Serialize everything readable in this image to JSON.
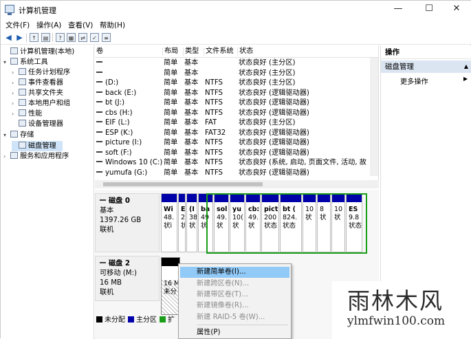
{
  "window": {
    "title": "计算机管理",
    "minimize": "—",
    "maximize": "☐",
    "close": "✕"
  },
  "menu": [
    "文件(F)",
    "操作(A)",
    "查看(V)",
    "帮助(H)"
  ],
  "tree": [
    {
      "label": "计算机管理(本地)",
      "arrow": ""
    },
    {
      "label": "系统工具",
      "arrow": "▾"
    },
    {
      "label": "任务计划程序",
      "arrow": "›"
    },
    {
      "label": "事件查看器",
      "arrow": "›"
    },
    {
      "label": "共享文件夹",
      "arrow": "›"
    },
    {
      "label": "本地用户和组",
      "arrow": "›"
    },
    {
      "label": "性能",
      "arrow": "›"
    },
    {
      "label": "设备管理器",
      "arrow": ""
    },
    {
      "label": "存储",
      "arrow": "▾"
    },
    {
      "label": "磁盘管理",
      "arrow": ""
    },
    {
      "label": "服务和应用程序",
      "arrow": "›"
    }
  ],
  "volumes": {
    "headers": [
      "卷",
      "布局",
      "类型",
      "文件系统",
      "状态"
    ],
    "rows": [
      [
        "",
        "简单",
        "基本",
        "",
        "状态良好 (主分区)"
      ],
      [
        "",
        "简单",
        "基本",
        "",
        "状态良好 (主分区)"
      ],
      [
        "(D:)",
        "简单",
        "基本",
        "NTFS",
        "状态良好 (主分区)"
      ],
      [
        "back (E:)",
        "简单",
        "基本",
        "NTFS",
        "状态良好 (逻辑驱动器)"
      ],
      [
        "bt (J:)",
        "简单",
        "基本",
        "NTFS",
        "状态良好 (逻辑驱动器)"
      ],
      [
        "cbs (H:)",
        "简单",
        "基本",
        "NTFS",
        "状态良好 (逻辑驱动器)"
      ],
      [
        "EIF (L:)",
        "简单",
        "基本",
        "FAT",
        "状态良好 (主分区)"
      ],
      [
        "ESP (K:)",
        "简单",
        "基本",
        "FAT32",
        "状态良好 (逻辑驱动器)"
      ],
      [
        "picture (I:)",
        "简单",
        "基本",
        "NTFS",
        "状态良好 (逻辑驱动器)"
      ],
      [
        "soft (F:)",
        "简单",
        "基本",
        "NTFS",
        "状态良好 (逻辑驱动器)"
      ],
      [
        "Windows 10 (C:)",
        "简单",
        "基本",
        "NTFS",
        "状态良好 (系统, 启动, 页面文件, 活动, 故"
      ],
      [
        "yumufa (G:)",
        "简单",
        "基本",
        "NTFS",
        "状态良好 (逻辑驱动器)"
      ]
    ]
  },
  "disk0": {
    "name": "磁盘 0",
    "type": "基本",
    "size": "1397.26 GB",
    "status": "联机",
    "partitions": [
      {
        "l1": "Wi",
        "l2": "48.",
        "l3": "状ì"
      },
      {
        "l1": "E",
        "l2": "2",
        "l3": "状"
      },
      {
        "l1": "(I",
        "l2": "38",
        "l3": "状"
      },
      {
        "l1": "ba",
        "l2": "49",
        "l3": "状"
      },
      {
        "l1": "sol",
        "l2": "49.",
        "l3": "状"
      },
      {
        "l1": "yu",
        "l2": "10(",
        "l3": "状"
      },
      {
        "l1": "cb:",
        "l2": "49.",
        "l3": "状"
      },
      {
        "l1": "pict",
        "l2": "200",
        "l3": "状态"
      },
      {
        "l1": "bt (",
        "l2": "824.",
        "l3": "状态"
      },
      {
        "l1": "",
        "l2": "10",
        "l3": "状"
      },
      {
        "l1": "",
        "l2": "8",
        "l3": "状"
      },
      {
        "l1": "",
        "l2": "10",
        "l3": "状"
      },
      {
        "l1": "ES",
        "l2": "9.8",
        "l3": "状态"
      }
    ]
  },
  "disk2": {
    "name": "磁盘 2",
    "type": "可移动 (M:)",
    "size": "16 MB",
    "status": "联机",
    "partition": {
      "l1": "16 M",
      "l2": "未分"
    }
  },
  "legend": [
    "未分配",
    "主分区",
    "扩"
  ],
  "legend_colors": {
    "unallocated": "#000000",
    "primary": "#0000a8",
    "extended": "#1a9e1a"
  },
  "actions": {
    "header": "操作",
    "section": "磁盘管理",
    "more": "更多操作"
  },
  "context_menu": {
    "items": [
      {
        "label": "新建简单卷(I)...",
        "state": "highlighted"
      },
      {
        "label": "新建跨区卷(N)...",
        "state": "disabled"
      },
      {
        "label": "新建带区卷(T)...",
        "state": "disabled"
      },
      {
        "label": "新建镜像卷(R)...",
        "state": "disabled"
      },
      {
        "label": "新建 RAID-5 卷(W)...",
        "state": "disabled"
      }
    ],
    "properties": "属性(P)"
  },
  "watermark": {
    "cn": "雨林木风",
    "en": "ylmfwin100.com"
  }
}
